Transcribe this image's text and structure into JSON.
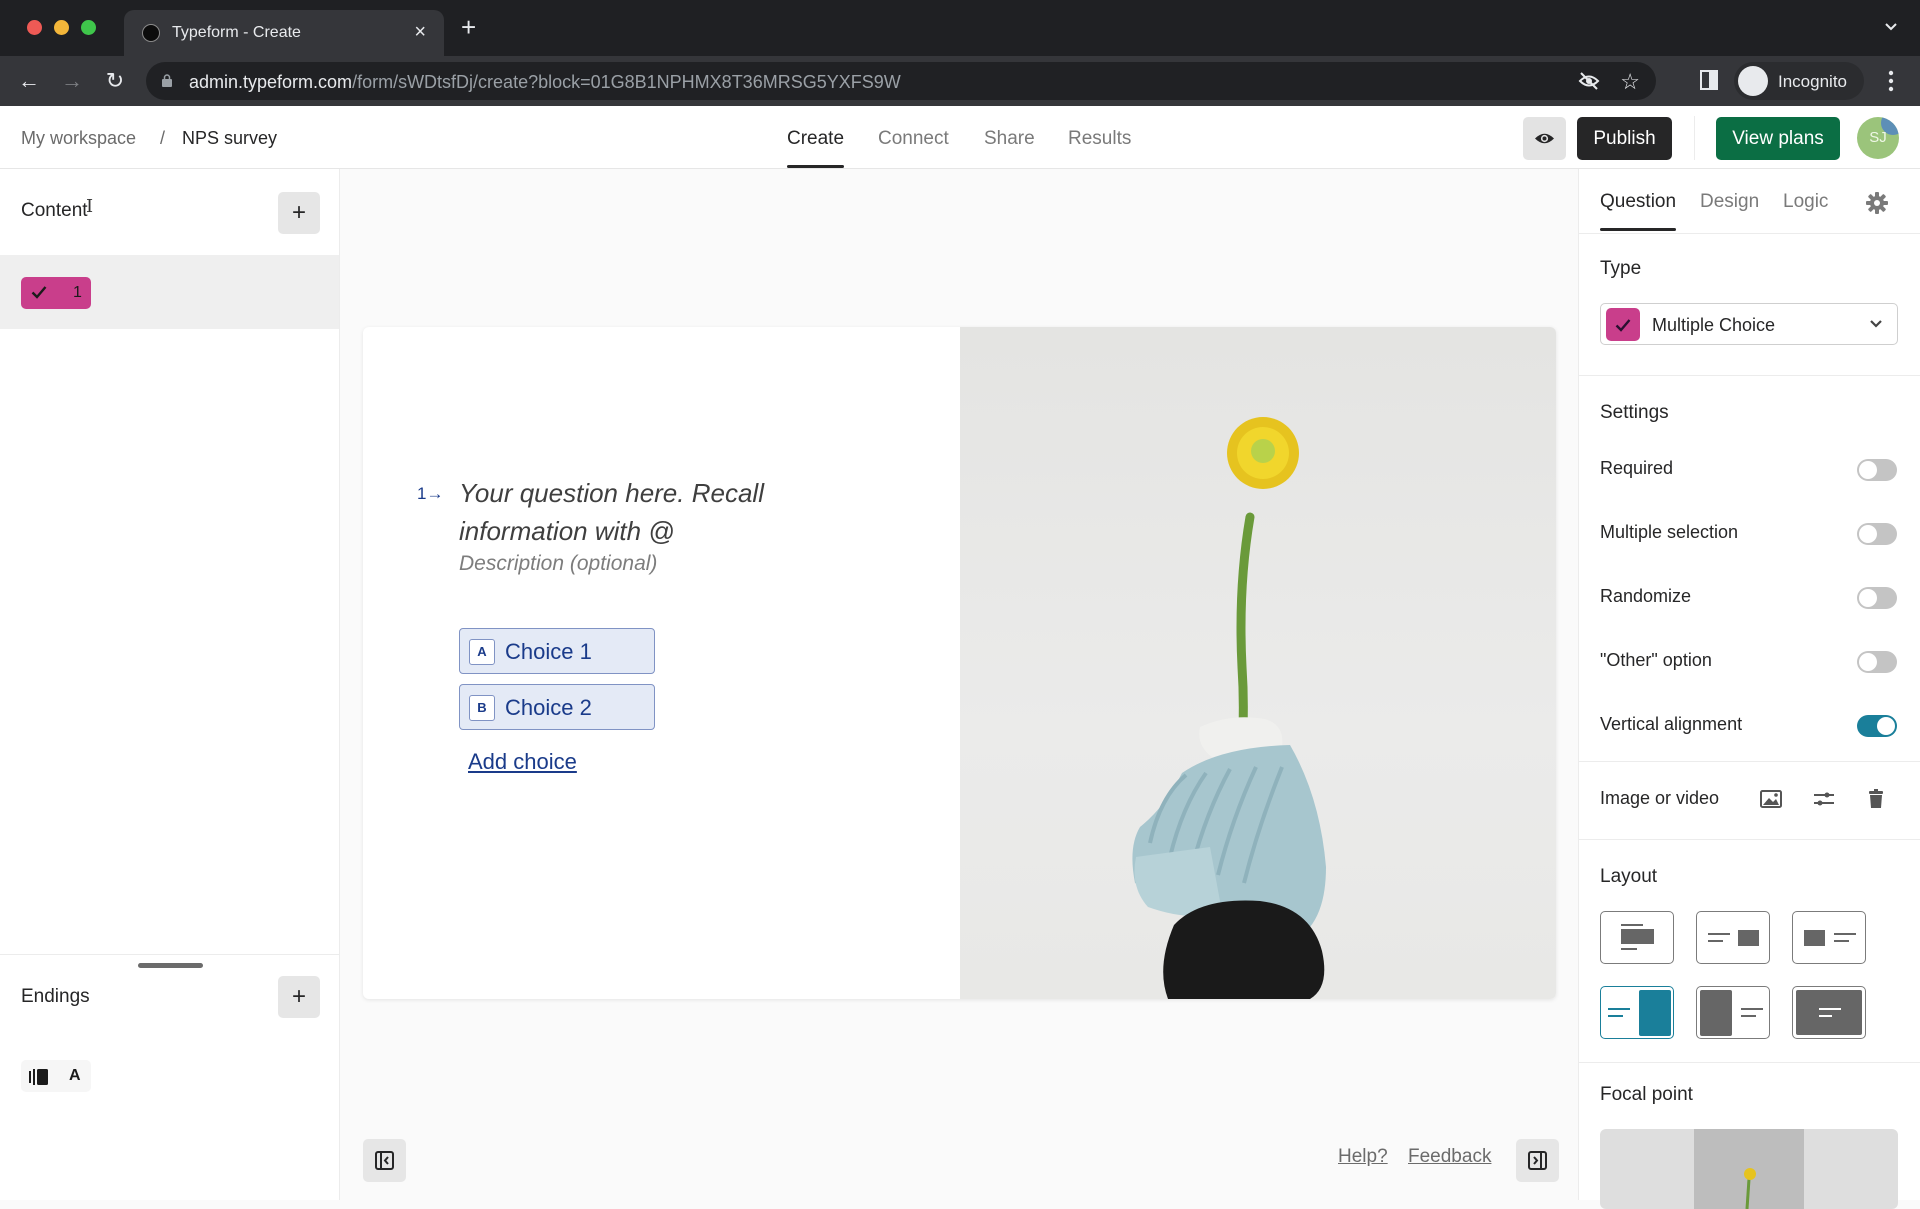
{
  "browser": {
    "tab_title": "Typeform - Create",
    "url_host": "admin.typeform.com",
    "url_path": "/form/sWDtsfDj/create?block=01G8B1NPHMX8T36MRSG5YXFS9W",
    "profile_label": "Incognito"
  },
  "header": {
    "breadcrumb": [
      "My workspace",
      "/",
      "NPS survey"
    ],
    "tabs": [
      {
        "label": "Create",
        "active": true
      },
      {
        "label": "Connect",
        "active": false
      },
      {
        "label": "Share",
        "active": false
      },
      {
        "label": "Results",
        "active": false
      }
    ],
    "publish_label": "Publish",
    "view_plans_label": "View plans",
    "avatar_initials": "SJ"
  },
  "left_panel": {
    "content_title": "Content",
    "add_symbol": "+",
    "questions": [
      {
        "number": "1",
        "type_icon": "check-icon",
        "color": "#c93e8b",
        "selected": true
      }
    ],
    "endings_title": "Endings",
    "endings": [
      {
        "letter": "A",
        "icon": "ending-icon"
      }
    ]
  },
  "question_card": {
    "number": "1",
    "arrow": "→",
    "question_placeholder": "Your question here. Recall information with @",
    "description_placeholder": "Description (optional)",
    "choices": [
      {
        "key": "A",
        "label": "Choice 1"
      },
      {
        "key": "B",
        "label": "Choice 2"
      }
    ],
    "add_choice_label": "Add choice",
    "image_description": "Yellow dandelion in a light-blue ribbed clay vase on a black clay base"
  },
  "footer": {
    "help_label": "Help?",
    "feedback_label": "Feedback"
  },
  "right_panel": {
    "tabs": [
      {
        "label": "Question",
        "active": true
      },
      {
        "label": "Design",
        "active": false
      },
      {
        "label": "Logic",
        "active": false
      }
    ],
    "type_heading": "Type",
    "type_value": "Multiple Choice",
    "type_color": "#c93e8b",
    "settings_heading": "Settings",
    "settings": [
      {
        "label": "Required",
        "on": false
      },
      {
        "label": "Multiple selection",
        "on": false
      },
      {
        "label": "Randomize",
        "on": false
      },
      {
        "label": "\"Other\" option",
        "on": false
      },
      {
        "label": "Vertical alignment",
        "on": true
      }
    ],
    "media_heading": "Image or video",
    "layout_heading": "Layout",
    "layout_selected_index": 3,
    "focal_heading": "Focal point",
    "accent_color": "#1a7f9a"
  }
}
